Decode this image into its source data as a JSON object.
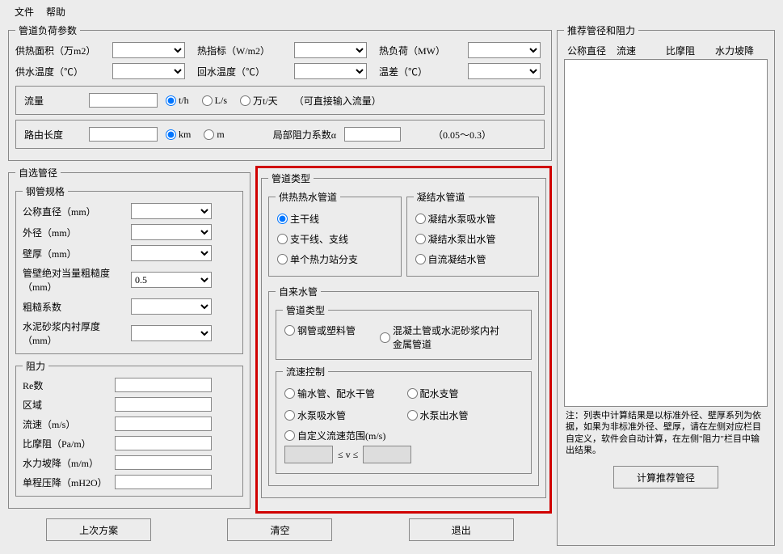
{
  "menu": {
    "file": "文件",
    "help": "帮助"
  },
  "loadParams": {
    "legend": "管道负荷参数",
    "heatArea": "供热面积（万m2）",
    "heatIndex": "热指标（W/m2）",
    "heatLoad": "热负荷（MW）",
    "supplyTemp": "供水温度（℃）",
    "returnTemp": "回水温度（℃）",
    "tempDiff": "温差（℃）",
    "flow": "流量",
    "flowUnit_th": "t/h",
    "flowUnit_ls": "L/s",
    "flowUnit_wtd": "万t/天",
    "flowNote": "（可直接输入流量）",
    "routeLen": "路由长度",
    "routeUnit_km": "km",
    "routeUnit_m": "m",
    "localRes": "局部阻力系数α",
    "localResRange": "（0.05～0.3）"
  },
  "selfPipe": {
    "legend": "自选管径",
    "steel": {
      "legend": "钢管规格",
      "dn": "公称直径（mm）",
      "od": "外径（mm）",
      "thick": "壁厚（mm）",
      "roughness": "管壁绝对当量粗糙度（mm）",
      "roughnessVal": "0.5",
      "roughCoef": "粗糙系数",
      "cementThick": "水泥砂浆内衬厚度（mm）"
    },
    "resistance": {
      "legend": "阻力",
      "re": "Re数",
      "zone": "区域",
      "velocity": "流速（m/s）",
      "friction": "比摩阻（Pa/m）",
      "hydGrad": "水力坡降（m/m）",
      "singleDrop": "单程压降（mH2O）"
    }
  },
  "pipeType": {
    "legend": "管道类型",
    "hotWater": {
      "legend": "供热热水管道",
      "main": "主干线",
      "branch": "支干线、支线",
      "single": "单个热力站分支"
    },
    "condensate": {
      "legend": "凝结水管道",
      "suction": "凝结水泵吸水管",
      "discharge": "凝结水泵出水管",
      "gravity": "自流凝结水管"
    },
    "tapWater": {
      "legend": "自来水管",
      "typeGroup": "管道类型",
      "steelPlastic": "钢管或塑料管",
      "concrete": "混凝土管或水泥砂浆内衬金属管道",
      "flowCtrl": {
        "legend": "流速控制",
        "delivery": "输水管、配水干管",
        "distBranch": "配水支管",
        "pumpSuction": "水泵吸水管",
        "pumpDischarge": "水泵出水管",
        "custom": "自定义流速范围(m/s)",
        "rangeMid": "≤ v ≤"
      }
    }
  },
  "recommend": {
    "legend": "推荐管径和阻力",
    "col1": "公称直径",
    "col2": "流速",
    "col3": "比摩阻",
    "col4": "水力坡降",
    "note": "注：列表中计算结果是以标准外径、壁厚系列为依据，如果为非标准外径、壁厚，请在左侧对应栏目自定义，软件会自动计算，在左侧\"阻力\"栏目中输出结果。",
    "calcBtn": "计算推荐管径"
  },
  "buttons": {
    "last": "上次方案",
    "clear": "清空",
    "exit": "退出"
  }
}
